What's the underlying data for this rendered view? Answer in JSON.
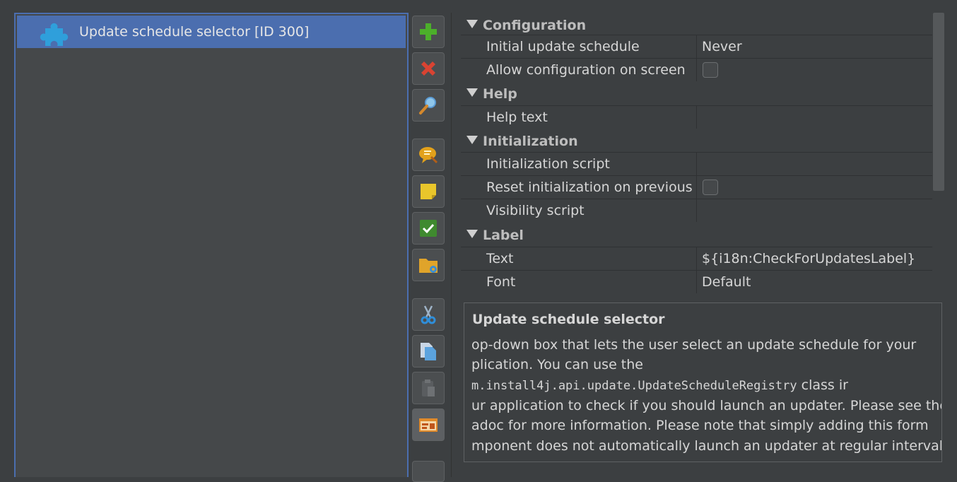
{
  "tree": {
    "selected_item": "Update schedule selector [ID 300]",
    "item_icon": "puzzle-piece-icon"
  },
  "toolbar": {
    "buttons": [
      {
        "name": "add-button",
        "icon": "plus-icon"
      },
      {
        "name": "delete-button",
        "icon": "red-x-icon"
      },
      {
        "name": "search-button",
        "icon": "magnifier-icon"
      },
      {
        "name": "comment-button",
        "icon": "speech-bubble-icon"
      },
      {
        "name": "note-button",
        "icon": "sticky-note-icon"
      },
      {
        "name": "check-button",
        "icon": "checkmark-icon"
      },
      {
        "name": "folder-button",
        "icon": "folder-gear-icon"
      },
      {
        "name": "cut-button",
        "icon": "scissors-icon"
      },
      {
        "name": "copy-button",
        "icon": "copy-icon"
      },
      {
        "name": "paste-button",
        "icon": "clipboard-icon"
      },
      {
        "name": "form-button",
        "icon": "form-component-icon"
      }
    ]
  },
  "properties": {
    "configuration": {
      "title": "Configuration",
      "initial_update_schedule": {
        "name": "Initial update schedule",
        "value": "Never"
      },
      "allow_configuration": {
        "name": "Allow configuration on screen",
        "checked": false
      }
    },
    "help": {
      "title": "Help",
      "help_text": {
        "name": "Help text",
        "value": ""
      }
    },
    "initialization": {
      "title": "Initialization",
      "init_script": {
        "name": "Initialization script",
        "value": ""
      },
      "reset_init": {
        "name": "Reset initialization on previous",
        "checked": false
      },
      "visibility_script": {
        "name": "Visibility script",
        "value": ""
      }
    },
    "label": {
      "title": "Label",
      "text": {
        "name": "Text",
        "value": "${i18n:CheckForUpdatesLabel}"
      },
      "font": {
        "name": "Font",
        "value": "Default"
      }
    }
  },
  "description": {
    "title": "Update schedule selector",
    "line1": "op-down box that lets the user select an update schedule for your",
    "line2": "plication. You can use the",
    "line3_code": "m.install4j.api.update.UpdateScheduleRegistry",
    "line3_rest": " class ir",
    "line4": "ur application to check if you should launch an updater. Please see the",
    "line5": "adoc for more information. Please note that simply adding this form",
    "line6": "mponent does not automatically launch an updater at regular intervals."
  },
  "colors": {
    "background": "#3c3f41",
    "selection": "#4b6eaf",
    "panel": "#45484a"
  }
}
